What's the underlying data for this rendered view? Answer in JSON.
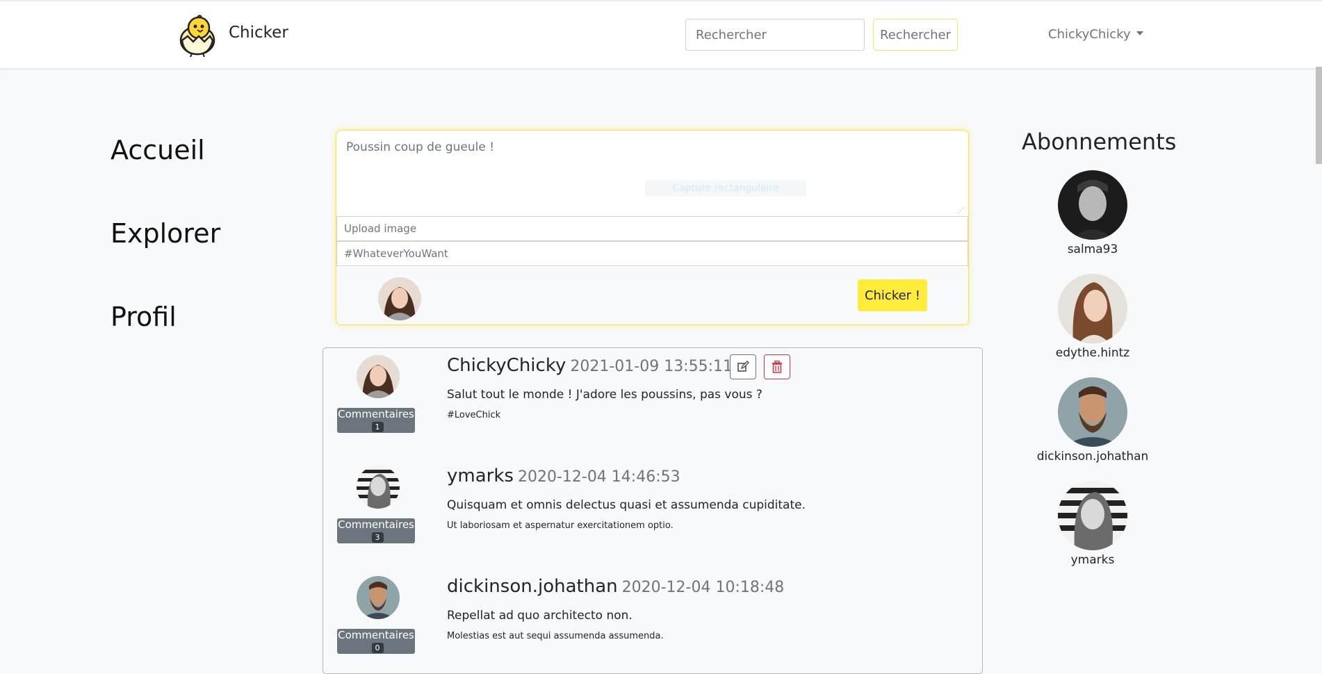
{
  "navbar": {
    "brand_name": "Chicker",
    "search_placeholder": "Rechercher",
    "search_button": "Rechercher",
    "user_menu": "ChickyChicky"
  },
  "left_nav": {
    "items": [
      "Accueil",
      "Explorer",
      "Profil"
    ]
  },
  "compose": {
    "text_placeholder": "Poussin coup de gueule !",
    "overlay_hint": "Capture rectangulaire",
    "upload_placeholder": "Upload image",
    "tag_placeholder": "#WhateverYouWant",
    "submit_label": "Chicker !"
  },
  "feed": {
    "comments_label": "Commentaires",
    "posts": [
      {
        "author": "ChickyChicky",
        "date": "2021-01-09 13:55:11",
        "text": "Salut tout le monde ! J'adore les poussins, pas vous ?",
        "tag": "#LoveChick",
        "comments": "1"
      },
      {
        "author": "ymarks",
        "date": "2020-12-04 14:46:53",
        "text": "Quisquam et omnis delectus quasi et assumenda cupiditate.",
        "tag": "Ut laboriosam et aspernatur exercitationem optio.",
        "comments": "3"
      },
      {
        "author": "dickinson.johathan",
        "date": "2020-12-04 10:18:48",
        "text": "Repellat ad quo architecto non.",
        "tag": "Molestias est aut sequi assumenda assumenda.",
        "comments": "0"
      }
    ]
  },
  "subscriptions": {
    "title": "Abonnements",
    "users": [
      "salma93",
      "edythe.hintz",
      "dickinson.johathan",
      "ymarks"
    ]
  },
  "colors": {
    "accent_yellow": "#ffeb3b",
    "secondary_gray": "#6c757d",
    "danger_red": "#dc3545"
  }
}
